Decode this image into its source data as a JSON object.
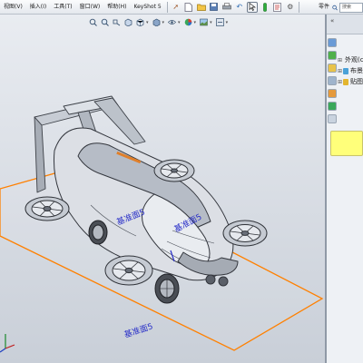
{
  "menubar": {
    "items": [
      {
        "name": "menu-view",
        "label": "视图(V)"
      },
      {
        "name": "menu-insert",
        "label": "插入(I)"
      },
      {
        "name": "menu-tools",
        "label": "工具(T)"
      },
      {
        "name": "menu-window",
        "label": "窗口(W)"
      },
      {
        "name": "menu-help",
        "label": "帮助(H)"
      },
      {
        "name": "menu-keyshot",
        "label": "KeyShot 5"
      }
    ],
    "toolbar_icons": [
      "new-file-icon",
      "open-file-icon",
      "save-icon",
      "print-icon",
      "undo-icon",
      "select-icon",
      "rebuild-icon",
      "file-properties-icon",
      "options-icon"
    ],
    "part_menu_label": "零件",
    "search_placeholder": "搜索"
  },
  "view_toolbar": {
    "icons": [
      "zoom-fit-icon",
      "zoom-area-icon",
      "previous-view-icon",
      "section-view-icon",
      "view-orientation-icon",
      "display-style-icon",
      "hide-show-icon",
      "appearance-icon",
      "scene-icon",
      "view-settings-icon"
    ]
  },
  "viewport": {
    "sketch_labels": [
      "基准面5",
      "基准面5",
      "基准面5"
    ],
    "sketch_color": "#ff8000",
    "label_color": "#2a30c8"
  },
  "task_pane": {
    "tabs": [
      "solidworks-resources-icon",
      "design-library-icon",
      "file-explorer-icon",
      "search-icon",
      "view-palette-icon",
      "appearances-icon",
      "custom-properties-icon"
    ],
    "tree": [
      {
        "label": "外观(co",
        "icon": "appearance-icon",
        "color": "#e0262a"
      },
      {
        "label": "布景",
        "icon": "scene-icon",
        "color": "#4aa1d8"
      },
      {
        "label": "贴图",
        "icon": "decal-icon",
        "color": "#e3b52f"
      }
    ],
    "preview_color": "#ffff7a"
  }
}
